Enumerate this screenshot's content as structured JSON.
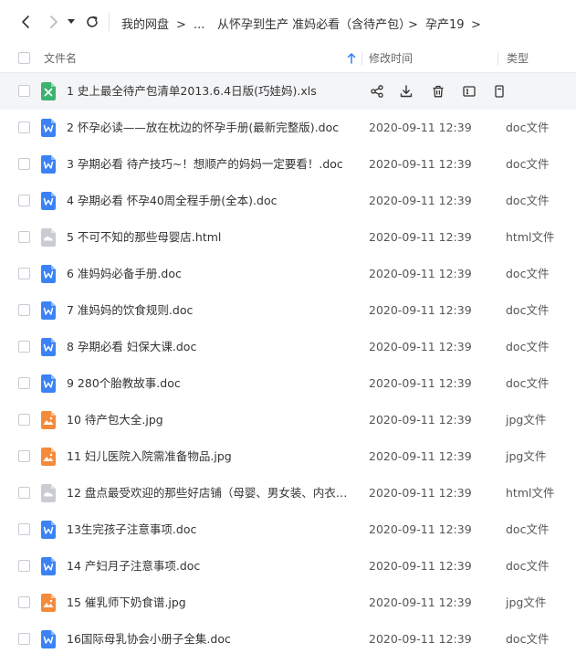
{
  "breadcrumb": {
    "root": "我的网盘",
    "ellipsis": "...",
    "folder": "从怀孕到生产 准妈必看（含待产包）",
    "current": "孕产19",
    "sep": ">"
  },
  "header": {
    "name": "文件名",
    "modified": "修改时间",
    "type": "类型"
  },
  "files": [
    {
      "name": "1 史上最全待产包清单2013.6.4日版(巧娃妈).xls",
      "date": "",
      "type": "",
      "icon": "xls-icon",
      "hover": true
    },
    {
      "name": "2 怀孕必读——放在枕边的怀孕手册(最新完整版).doc",
      "date": "2020-09-11 12:39",
      "type": "doc文件",
      "icon": "doc-icon"
    },
    {
      "name": "3 孕期必看  待产技巧~！想顺产的妈妈一定要看！.doc",
      "date": "2020-09-11 12:39",
      "type": "doc文件",
      "icon": "doc-icon"
    },
    {
      "name": "4 孕期必看  怀孕40周全程手册(全本).doc",
      "date": "2020-09-11 12:39",
      "type": "doc文件",
      "icon": "doc-icon"
    },
    {
      "name": "5 不可不知的那些母婴店.html",
      "date": "2020-09-11 12:39",
      "type": "html文件",
      "icon": "html-icon"
    },
    {
      "name": "6 准妈妈必备手册.doc",
      "date": "2020-09-11 12:39",
      "type": "doc文件",
      "icon": "doc-icon"
    },
    {
      "name": "7 准妈妈的饮食规则.doc",
      "date": "2020-09-11 12:39",
      "type": "doc文件",
      "icon": "doc-icon"
    },
    {
      "name": "8 孕期必看 妇保大课.doc",
      "date": "2020-09-11 12:39",
      "type": "doc文件",
      "icon": "doc-icon"
    },
    {
      "name": "9  280个胎教故事.doc",
      "date": "2020-09-11 12:39",
      "type": "doc文件",
      "icon": "doc-icon"
    },
    {
      "name": "10 待产包大全.jpg",
      "date": "2020-09-11 12:39",
      "type": "jpg文件",
      "icon": "jpg-icon"
    },
    {
      "name": "11 妇儿医院入院需准备物品.jpg",
      "date": "2020-09-11 12:39",
      "type": "jpg文件",
      "icon": "jpg-icon"
    },
    {
      "name": "12 盘点最受欢迎的那些好店铺（母婴、男女装、内衣、...",
      "date": "2020-09-11 12:39",
      "type": "html文件",
      "icon": "html-icon"
    },
    {
      "name": "13生完孩子注意事项.doc",
      "date": "2020-09-11 12:39",
      "type": "doc文件",
      "icon": "doc-icon"
    },
    {
      "name": "14 产妇月子注意事项.doc",
      "date": "2020-09-11 12:39",
      "type": "doc文件",
      "icon": "doc-icon"
    },
    {
      "name": "15 催乳师下奶食谱.jpg",
      "date": "2020-09-11 12:39",
      "type": "jpg文件",
      "icon": "jpg-icon"
    },
    {
      "name": "16国际母乳协会小册子全集.doc",
      "date": "2020-09-11 12:39",
      "type": "doc文件",
      "icon": "doc-icon"
    }
  ],
  "colors": {
    "doc": "#3b82f6",
    "xls": "#3cb371",
    "jpg": "#f58a3a",
    "html": "#c9ccd2",
    "accent": "#2f7df6"
  }
}
